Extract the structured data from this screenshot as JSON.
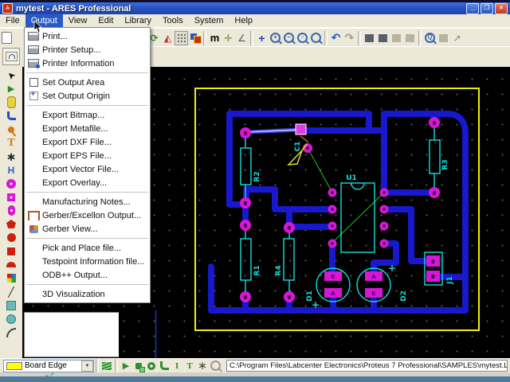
{
  "titlebar": {
    "title": "mytest - ARES Professional"
  },
  "menubar": {
    "items": [
      "File",
      "Output",
      "View",
      "Edit",
      "Library",
      "Tools",
      "System",
      "Help"
    ],
    "active": "Output"
  },
  "output_menu": {
    "items": [
      "Print...",
      "Printer Setup...",
      "Printer Information",
      "Set Output Area",
      "Set Output Origin",
      "Export Bitmap...",
      "Export Metafile...",
      "Export DXF File...",
      "Export EPS File...",
      "Export Vector File...",
      "Export Overlay...",
      "Manufacturing Notes...",
      "Gerber/Excellon Output...",
      "Gerber View...",
      "Pick and Place file...",
      "Testpoint Information file...",
      "ODB++ Output...",
      "3D Visualization"
    ],
    "icons": [
      "printer",
      "printer-setup",
      "printer-information",
      "set-output-area",
      "set-output-origin",
      "gerber-excellon",
      "gerber-view"
    ]
  },
  "toolbar": {
    "icons": [
      "new-page",
      "redraw",
      "flip",
      "grid-toggle",
      "layers",
      "metric-toggle",
      "origin",
      "snap-angle",
      "pan",
      "zoom-in",
      "zoom-out",
      "zoom-area",
      "zoom-all",
      "undo",
      "redo",
      "cut",
      "copy",
      "paste-disabled",
      "block-disabled",
      "search-tag",
      "tag-filter-disabled",
      "measure"
    ]
  },
  "left_toolbar": {
    "tools": [
      "package-mode",
      "selection",
      "component",
      "package",
      "trace",
      "via",
      "component-edge",
      "ratsnest",
      "connectivity-highlight",
      "round-through-pad",
      "square-through-pad",
      "dil-pad",
      "edge-connector-pad",
      "circular-smt-pad",
      "rect-smt-pad",
      "polygonal-smt-pad",
      "padstack",
      "2d-line",
      "2d-box",
      "2d-circle",
      "2d-arc"
    ]
  },
  "pcb": {
    "labels": {
      "r1": "R1",
      "r2": "R2",
      "r3": "R3",
      "r4": "R4",
      "u1": "U1",
      "c1": "C1",
      "d1": "D1",
      "d2": "D2",
      "j1": "J1"
    },
    "pad_marks": {
      "one": "1",
      "two": "2",
      "k": "K",
      "a": "A",
      "plus": "+"
    },
    "colors": {
      "background": "#000000",
      "board_edge": "#f0f000",
      "trace": "#1818cc",
      "pad": "#d816d8",
      "silkscreen": "#12dede",
      "ratsnest": "#12b412"
    }
  },
  "bottom_bar": {
    "layer_selector": {
      "value": "Board Edge",
      "swatch_color": "#ffff00"
    },
    "path_display": "C:\\Program Files\\Labcenter Electronics\\Proteus 7 Professional\\SAMPLES\\mytest.LYT"
  }
}
